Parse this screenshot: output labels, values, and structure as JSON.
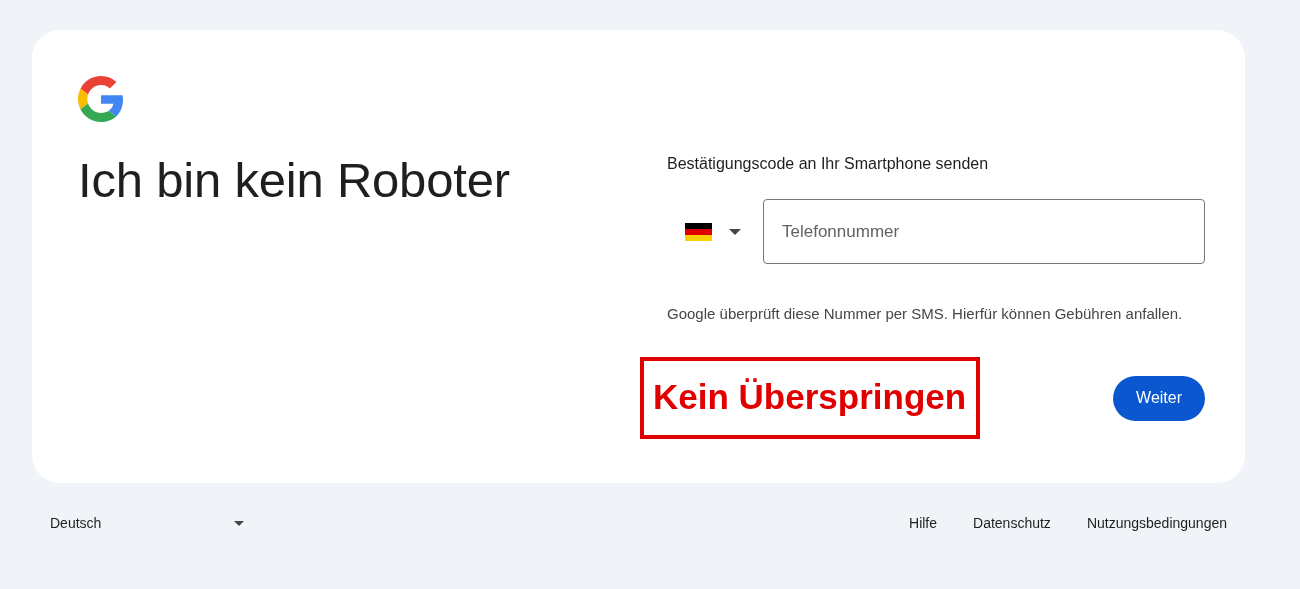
{
  "heading": "Ich bin kein Roboter",
  "prompt": "Bestätigungscode an Ihr Smartphone senden",
  "phone_field": {
    "placeholder": "Telefonnummer"
  },
  "notice": "Google überprüft diese Nummer per SMS. Hierfür können Gebühren anfallen.",
  "annotation": "Kein Überspringen",
  "buttons": [
    {
      "label": "Weiter",
      "kind": "primary"
    }
  ],
  "footer": {
    "language": "Deutsch",
    "links": [
      "Hilfe",
      "Datenschutz",
      "Nutzungsbedingungen"
    ]
  }
}
